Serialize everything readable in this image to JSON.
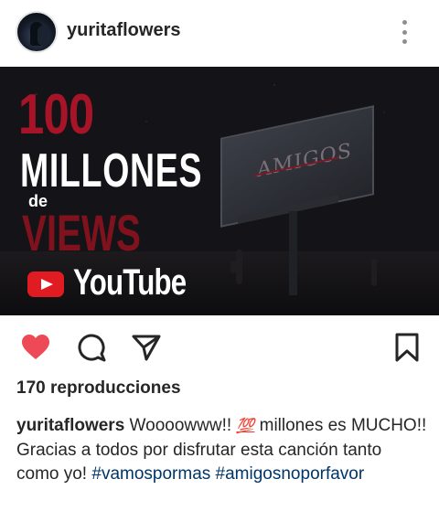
{
  "header": {
    "username": "yuritaflowers"
  },
  "media": {
    "line1": "100",
    "line2": "MILLONES",
    "line3": "de",
    "line4": "VIEWS",
    "platform": "YouTube",
    "billboard_text": "AMIGOS"
  },
  "actions": {
    "like_color": "#ed4956"
  },
  "stats": {
    "views_text": "170 reproducciones"
  },
  "caption": {
    "username": "yuritaflowers",
    "text_part1": "Woooowww!!",
    "emoji": "💯",
    "text_part2": "millones es MUCHO!! Gracias a todos por disfrutar esta canción tanto como yo!",
    "hashtag1": "#vamospormas",
    "hashtag2": "#amigosnoporfavor"
  }
}
